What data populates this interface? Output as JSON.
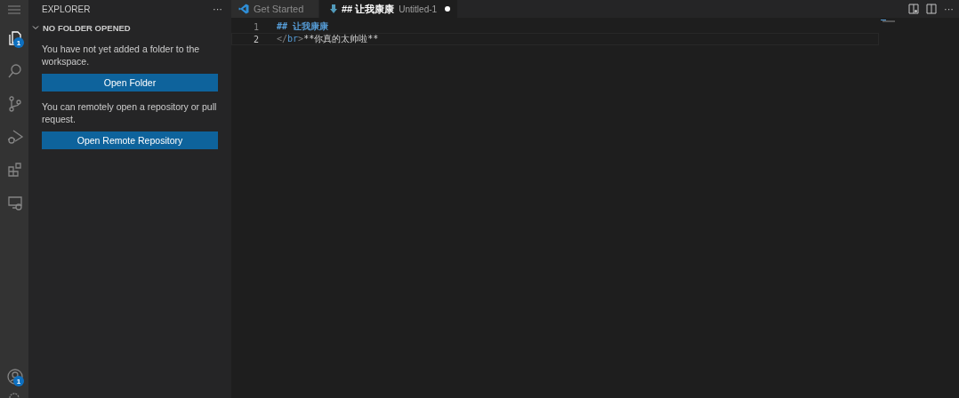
{
  "activity_bar": {
    "items": [
      {
        "kind": "files",
        "selected": true,
        "badge": "1"
      },
      {
        "kind": "search",
        "selected": false
      },
      {
        "kind": "source-control",
        "selected": false
      },
      {
        "kind": "run-debug",
        "selected": false
      },
      {
        "kind": "extensions",
        "selected": false
      },
      {
        "kind": "remote",
        "selected": false
      }
    ],
    "account_badge": "1"
  },
  "sidebar": {
    "title": "EXPLORER",
    "actions": "···",
    "section": {
      "title": "NO FOLDER OPENED",
      "expanded": true,
      "content": [
        {
          "kind": "text",
          "text": "You have not yet added a folder to the workspace."
        },
        {
          "kind": "button",
          "text": "Open Folder"
        },
        {
          "kind": "text",
          "text": "You can remotely open a repository or pull request."
        },
        {
          "kind": "button",
          "text": "Open Remote Repository"
        }
      ]
    }
  },
  "tabs": [
    {
      "kind": "welcome",
      "label": "Get Started",
      "selected": false,
      "dirty": false
    },
    {
      "kind": "markdown",
      "label": "## 让我康康",
      "description": "Untitled-1",
      "selected": true,
      "dirty": true
    }
  ],
  "editor_actions": "···",
  "editor": {
    "lines": [
      {
        "number": "1",
        "current": false,
        "tokens": [
          {
            "kind": "heading",
            "text": "## 让我康康"
          }
        ]
      },
      {
        "number": "2",
        "current": true,
        "tokens": [
          {
            "kind": "punct",
            "text": "</"
          },
          {
            "kind": "tag",
            "text": "br"
          },
          {
            "kind": "punct",
            "text": ">"
          },
          {
            "kind": "text",
            "text": "**你真的太帅啦**"
          }
        ]
      }
    ]
  }
}
